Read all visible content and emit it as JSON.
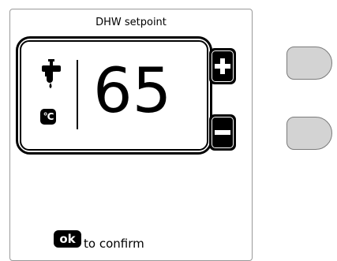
{
  "panel": {
    "title": "DHW setpoint"
  },
  "display": {
    "value": "65",
    "unit_icon_text": "°C",
    "mode_icon": "tap-icon"
  },
  "buttons": {
    "increase": {
      "icon": "plus-icon"
    },
    "decrease": {
      "icon": "minus-icon"
    }
  },
  "footer": {
    "ok_label": "ok",
    "confirm_text": "to confirm"
  },
  "colors": {
    "button_gray": "#d3d3d3",
    "border": "#000000"
  }
}
